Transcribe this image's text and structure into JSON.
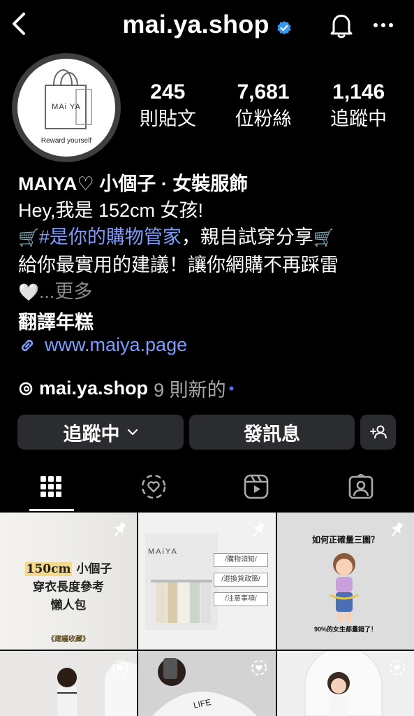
{
  "header": {
    "username": "mai.ya.shop",
    "verified": true,
    "icons": [
      "back-chevron-icon",
      "verified-badge-icon",
      "bell-icon",
      "more-dots-icon"
    ]
  },
  "profile": {
    "avatar_brand": "MAi YA",
    "avatar_tagline": "Reward yourself",
    "stats": [
      {
        "value": "245",
        "label": "則貼文"
      },
      {
        "value": "7,681",
        "label": "位粉絲"
      },
      {
        "value": "1,146",
        "label": "追蹤中"
      }
    ]
  },
  "bio": {
    "name_line": "MAIYA♡ 小個子 · 女裝服飾",
    "line2": "Hey,我是 152cm 女孩!",
    "line3_hashtag": "#是你的購物管家",
    "line3_text": "，親自試穿分享",
    "line4": "給你最實用的建議！讓你網購不再踩雷",
    "line5_more": "...更多",
    "translate": "翻譯年糕",
    "link": "www.maiya.page"
  },
  "threads": {
    "handle": "mai.ya.shop",
    "new_count": "9 則新的"
  },
  "buttons": {
    "following": "追蹤中",
    "message": "發訊息"
  },
  "tabs": [
    "grid-icon",
    "collab-icon",
    "reels-icon",
    "tagged-icon"
  ],
  "posts": {
    "post1": {
      "highlight": "150cm",
      "line1_rest": " 小個子",
      "line2": "穿衣長度參考",
      "line3": "懶人包",
      "line4": "《建議收藏》"
    },
    "post2": {
      "brand": "MAiYA",
      "tags": [
        "/購物須知/",
        "/退換貨政策/",
        "/注意事項/"
      ]
    },
    "post3": {
      "title": "如何正確量三圍？",
      "footer": "90%的女生都量錯了！"
    }
  },
  "colors": {
    "background": "#000000",
    "button_bg": "#2b2c30",
    "link": "#7f9cff",
    "verified": "#3897f0"
  }
}
